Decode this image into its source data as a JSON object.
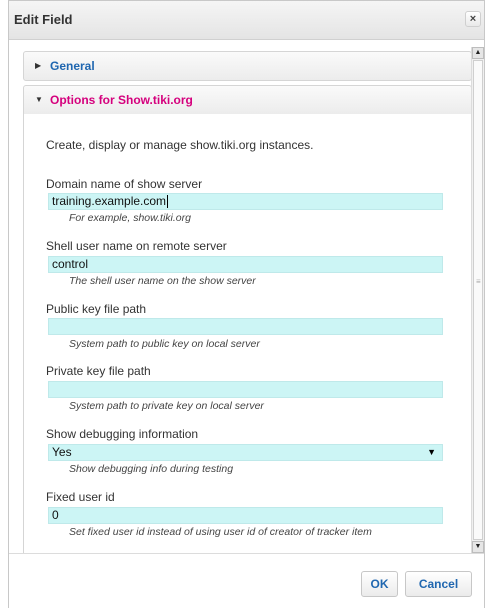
{
  "dialog": {
    "title": "Edit Field",
    "close_glyph": "×"
  },
  "sections": {
    "general": {
      "label": "General",
      "indicator": "collapsed-arrow-icon"
    },
    "options": {
      "label": "Options for Show.tiki.org",
      "indicator": "expanded-arrow-icon"
    }
  },
  "intro_text": "Create, display or manage show.tiki.org instances.",
  "fields": {
    "domain": {
      "label": "Domain name of show server",
      "value": "training.example.com",
      "hint": "For example, show.tiki.org"
    },
    "shell_user": {
      "label": "Shell user name on remote server",
      "value": "control",
      "hint": "The shell user name on the show server"
    },
    "public_key": {
      "label": "Public key file path",
      "value": "",
      "hint": "System path to public key on local server"
    },
    "private_key": {
      "label": "Private key file path",
      "value": "",
      "hint": "System path to private key on local server"
    },
    "debug": {
      "label": "Show debugging information",
      "value": "Yes",
      "hint": "Show debugging info during testing"
    },
    "fixed_user": {
      "label": "Fixed user id",
      "value": "0",
      "hint": "Set fixed user id instead of using user id of creator of tracker item"
    }
  },
  "buttons": {
    "ok": "OK",
    "cancel": "Cancel"
  },
  "colors": {
    "accent_link": "#2067b0",
    "section_active": "#d5007d",
    "field_bg": "#ccf5f5"
  }
}
